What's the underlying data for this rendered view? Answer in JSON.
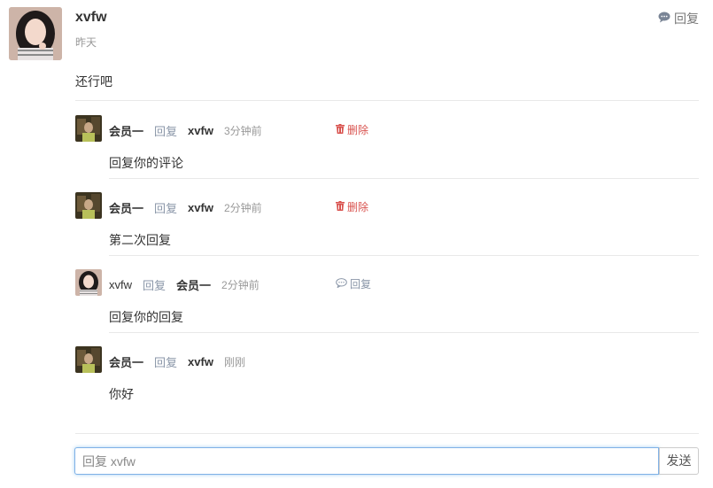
{
  "comment": {
    "author": "xvfw",
    "time": "昨天",
    "reply_label": "回复",
    "content": "还行吧"
  },
  "replies": [
    {
      "name": "会员一",
      "reply_word": "回复",
      "target": "xvfw",
      "time": "3分钟前",
      "action": "删除",
      "content": "回复你的评论"
    },
    {
      "name": "会员一",
      "reply_word": "回复",
      "target": "xvfw",
      "time": "2分钟前",
      "action": "删除",
      "content": "第二次回复"
    },
    {
      "name": "xvfw",
      "reply_word": "回复",
      "target": "会员一",
      "time": "2分钟前",
      "action": "回复",
      "content": "回复你的回复"
    },
    {
      "name": "会员一",
      "reply_word": "回复",
      "target": "xvfw",
      "time": "刚刚",
      "action": "",
      "content": "你好"
    }
  ],
  "reply_box": {
    "placeholder": "回复 xvfw",
    "send_label": "发送"
  },
  "colors": {
    "delete": "#d9534f",
    "reply": "#8a96a8",
    "focus_border": "#7fb1e6"
  }
}
